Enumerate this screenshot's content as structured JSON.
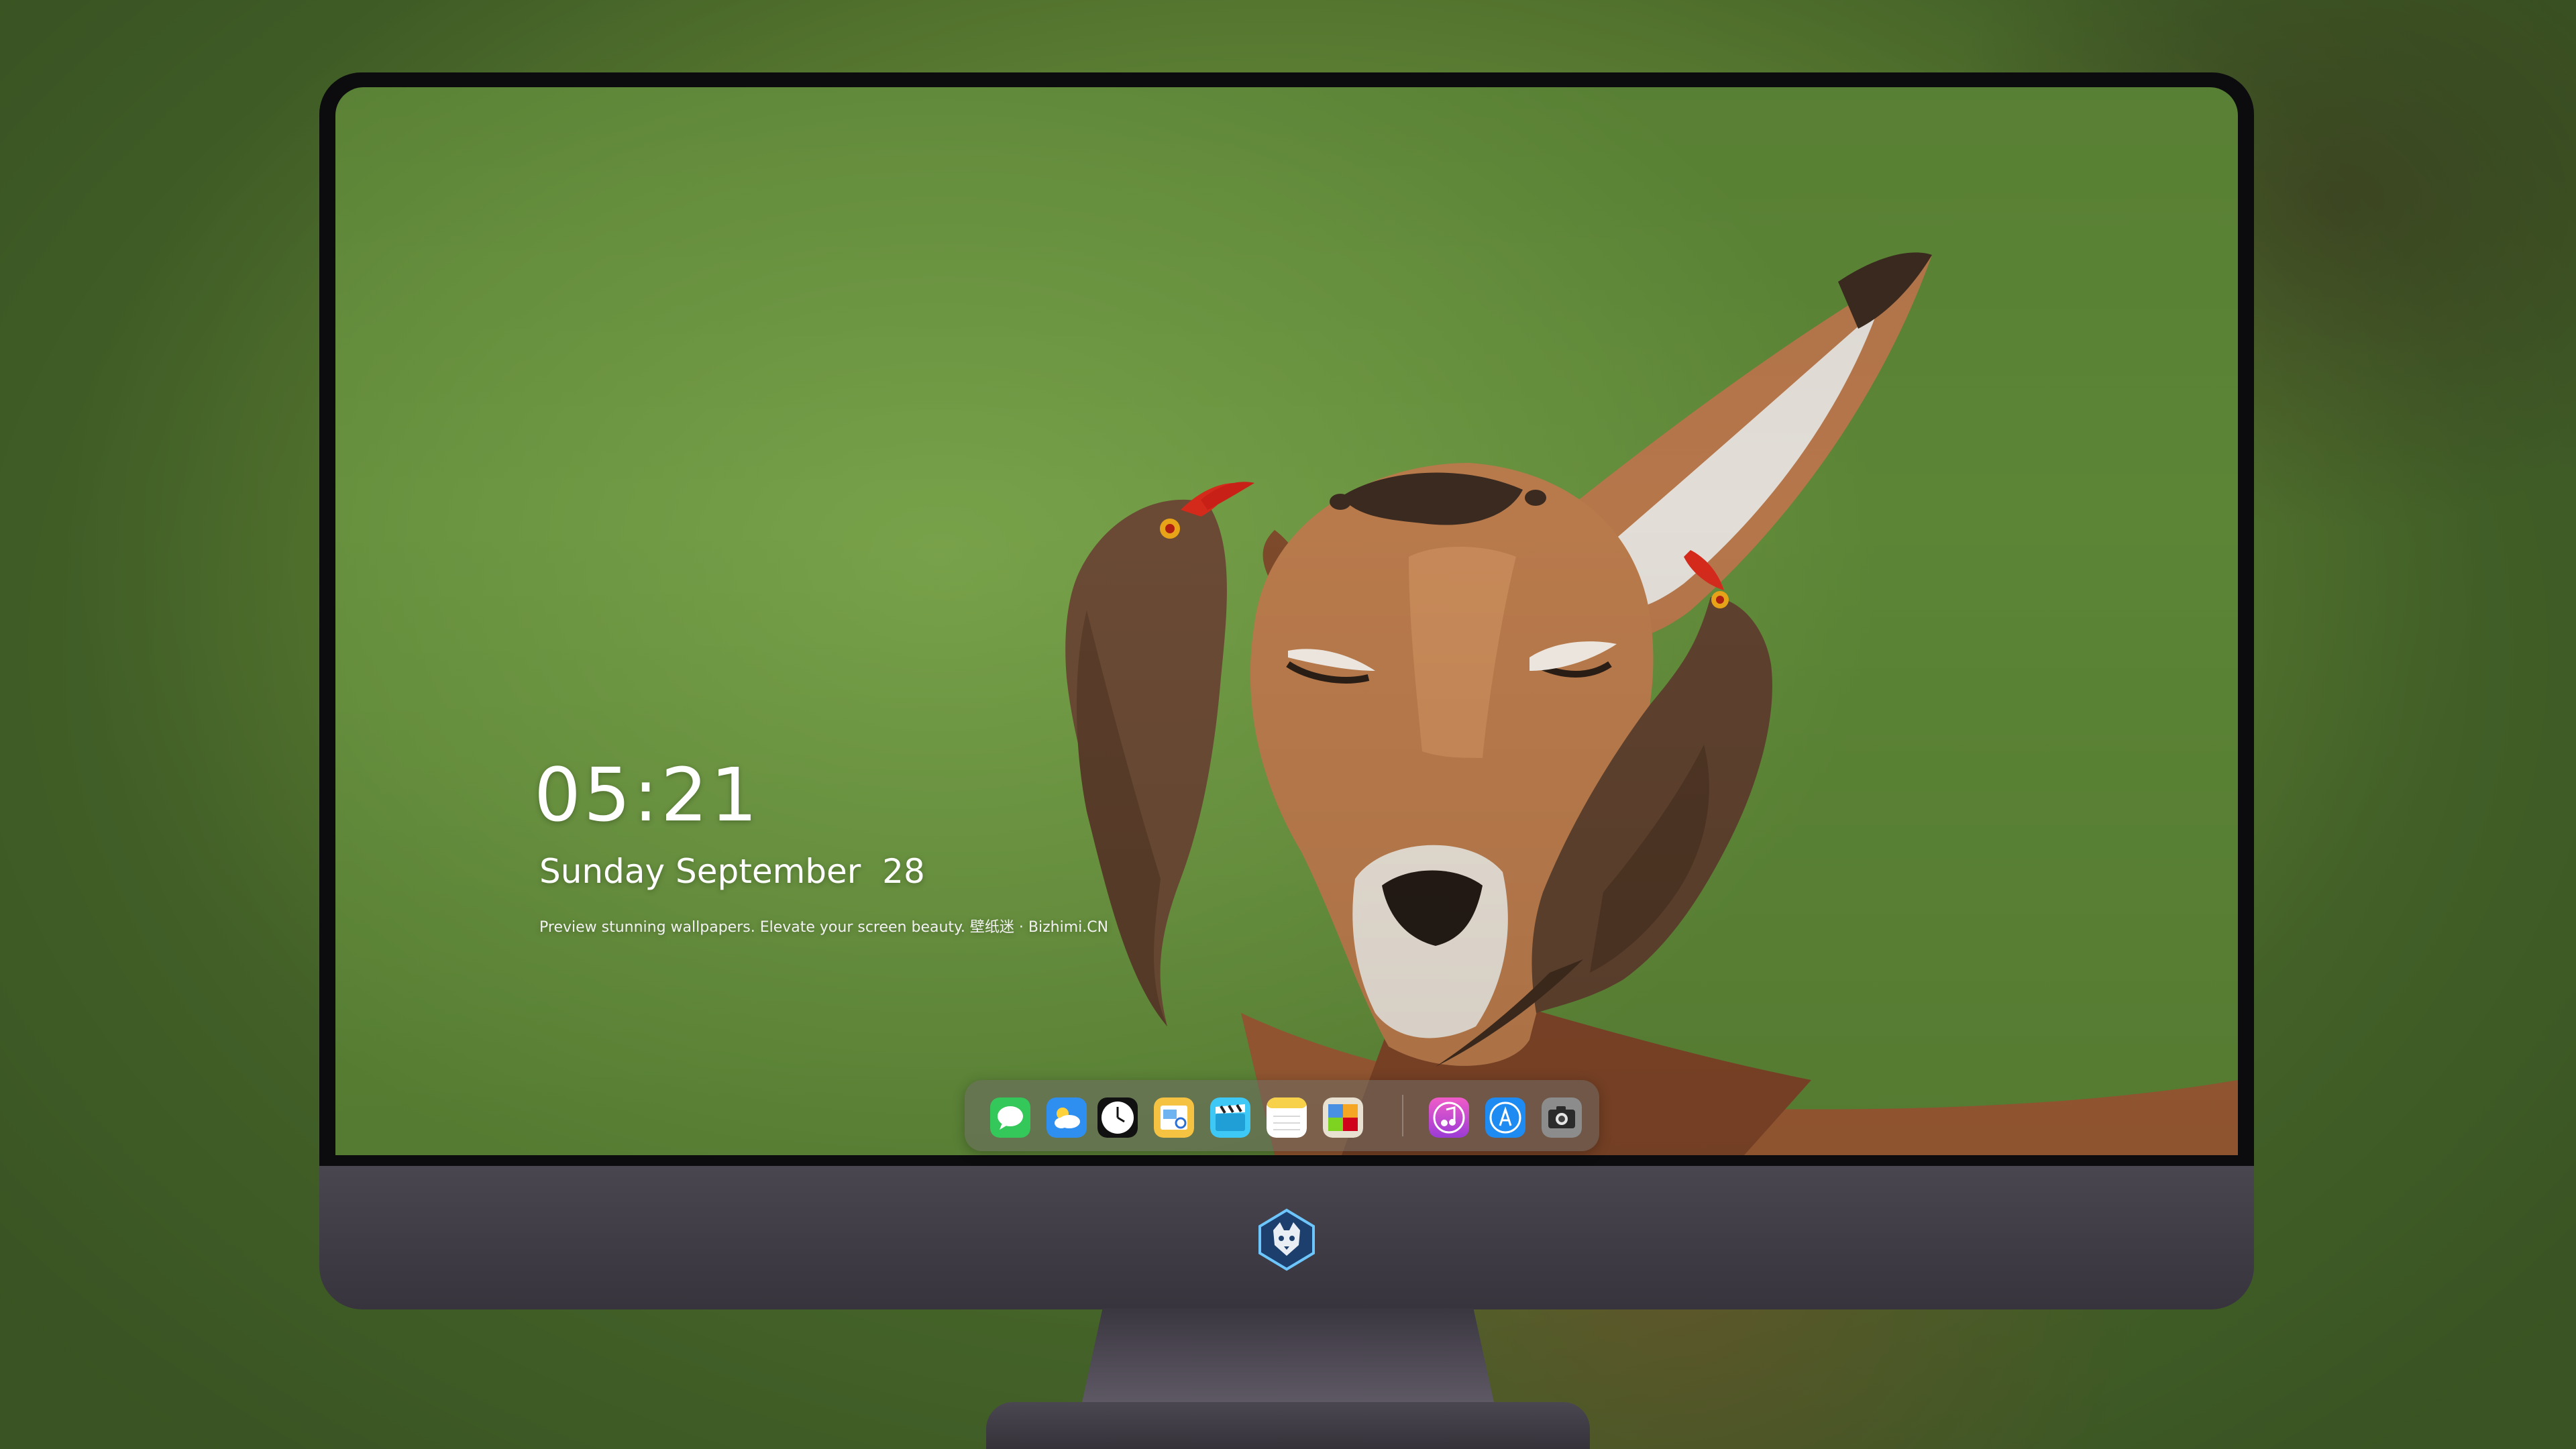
{
  "lock_screen": {
    "time": "05:21",
    "date": "Sunday September  28",
    "caption": "Preview stunning wallpapers. Elevate your screen beauty. 壁纸迷 · Bizhimi.CN"
  },
  "dock": {
    "apps": [
      {
        "name": "messages-icon",
        "color": "#34c759"
      },
      {
        "name": "weather-icon",
        "color": "#2f8ff0"
      },
      {
        "name": "clock-icon",
        "color": "#111111"
      },
      {
        "name": "preview-icon",
        "color": "#f5c242"
      },
      {
        "name": "claquette-icon",
        "color": "#3ec8f5"
      },
      {
        "name": "notes-icon",
        "color": "#f7d14a"
      },
      {
        "name": "photo-app-icon",
        "color": "#e8e0d0"
      },
      {
        "name": "music-icon",
        "color": "#d44ad8"
      },
      {
        "name": "app-store-icon",
        "color": "#1e8bf2"
      },
      {
        "name": "camera-icon",
        "color": "#8c8c8c"
      }
    ]
  },
  "monitor": {
    "logo": "wolf-emblem-icon"
  }
}
